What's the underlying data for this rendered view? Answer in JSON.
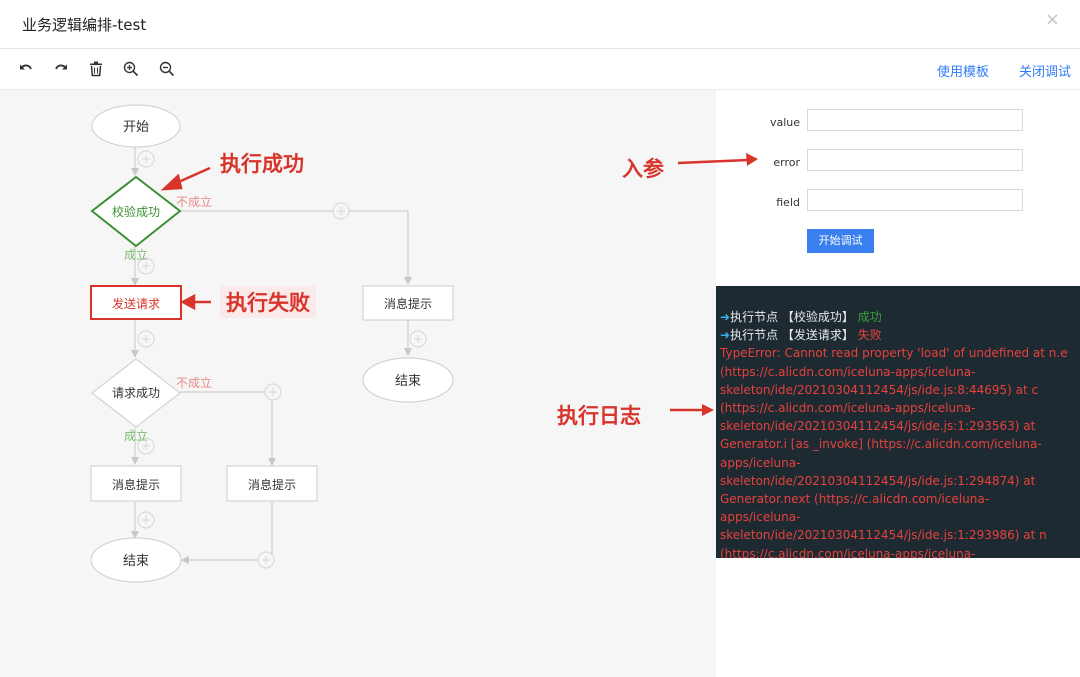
{
  "window": {
    "title": "业务逻辑编排-test",
    "close_glyph": "×"
  },
  "toolbar": {
    "icons": [
      "undo-icon",
      "redo-icon",
      "delete-icon",
      "zoom-in-icon",
      "zoom-out-icon"
    ],
    "use_template": "使用模板",
    "close_debug": "关闭调试"
  },
  "flow": {
    "start": "开始",
    "verify": "校验成功",
    "verify_no": "不成立",
    "verify_yes": "成立",
    "send_request": "发送请求",
    "msg_right": "消息提示",
    "end_right": "结束",
    "request_ok": "请求成功",
    "request_no": "不成立",
    "request_yes": "成立",
    "msg_left": "消息提示",
    "msg_mid": "消息提示",
    "end_bottom": "结束"
  },
  "annotations": {
    "exec_success": "执行成功",
    "exec_fail": "执行失败",
    "input_params": "入参",
    "exec_log": "执行日志"
  },
  "params": {
    "value_label": "value",
    "error_label": "error",
    "field_label": "field",
    "start_button": "开始调试"
  },
  "log": {
    "line1_text": "执行节点 【校验成功】",
    "line1_status": "成功",
    "line2_text": "执行节点 【发送请求】",
    "line2_status": "失败",
    "error_lines": [
      "TypeError: Cannot read property 'load' of undefined at n.e",
      "(https://c.alicdn.com/iceluna-apps/iceluna-",
      "skeleton/ide/20210304112454/js/ide.js:8:44695) at c",
      "(https://c.alicdn.com/iceluna-apps/iceluna-",
      "skeleton/ide/20210304112454/js/ide.js:1:293563) at",
      "Generator.i [as _invoke] (https://c.alicdn.com/iceluna-",
      "apps/iceluna-",
      "skeleton/ide/20210304112454/js/ide.js:1:294874) at",
      "Generator.next (https://c.alicdn.com/iceluna-",
      "apps/iceluna-",
      "skeleton/ide/20210304112454/js/ide.js:1:293986) at n",
      "(https://c.alicdn.com/iceluna-apps/iceluna-"
    ]
  },
  "colors": {
    "accent": "#2f7cf6",
    "success": "#2e8b2e",
    "error": "#d9342b",
    "console_bg": "#1d2a32"
  }
}
